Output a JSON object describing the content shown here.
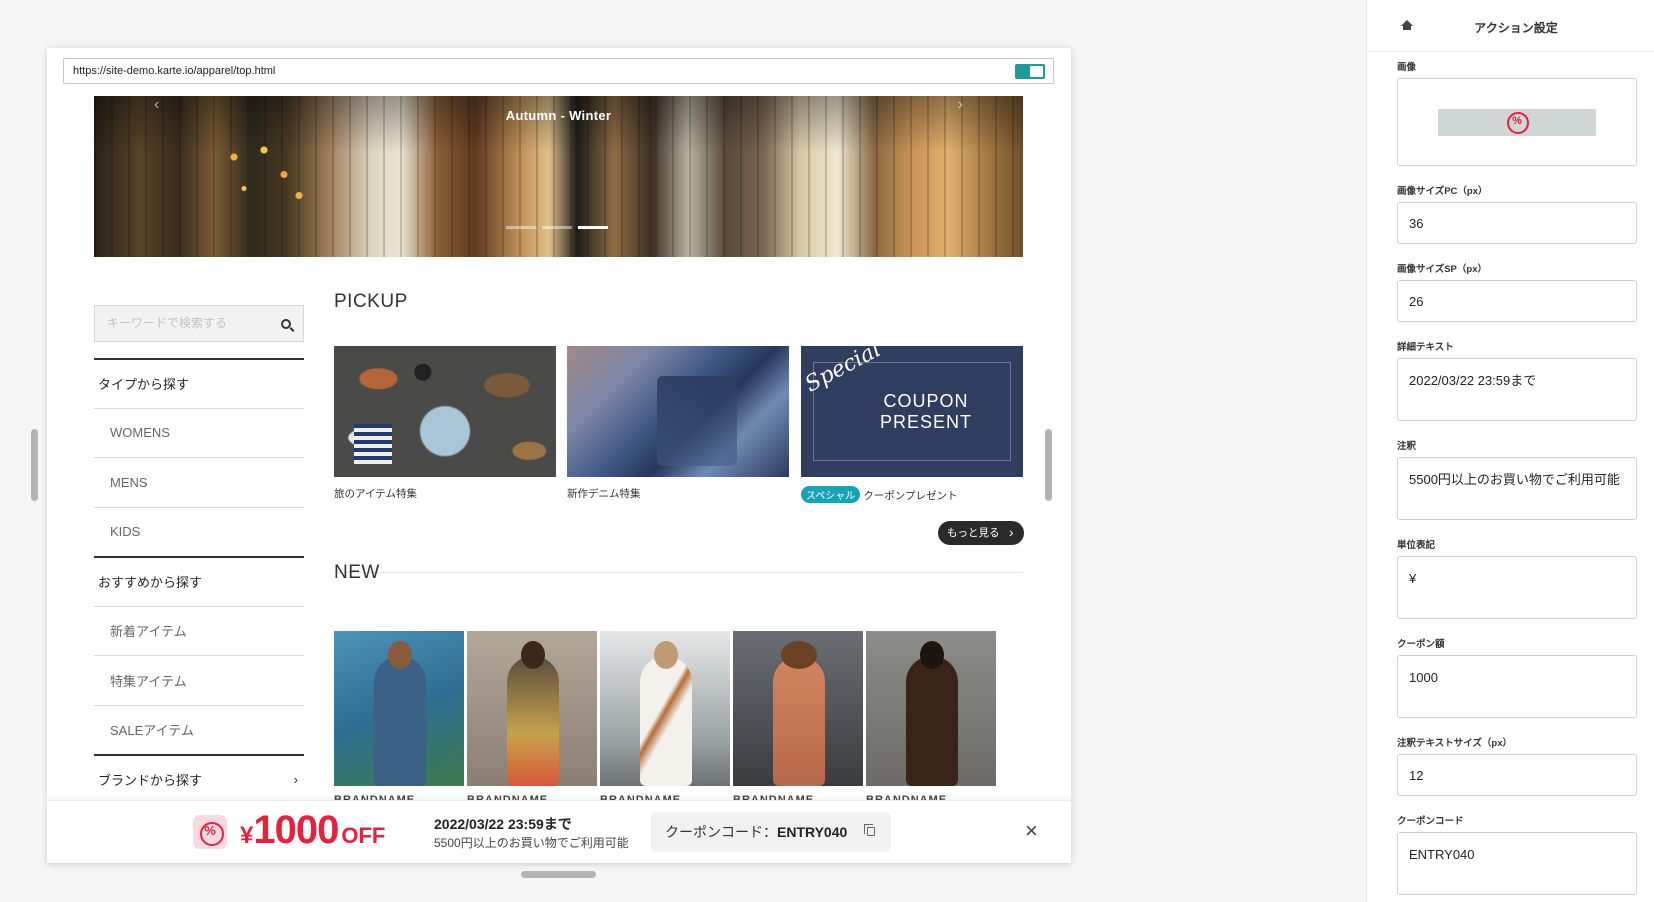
{
  "browser": {
    "url": "https://site-demo.karte.io/apparel/top.html"
  },
  "hero": {
    "title": "Autumn - Winter",
    "dot_count": 3,
    "active_dot": 3
  },
  "search": {
    "placeholder": "キーワードで検索する"
  },
  "sidebar": {
    "items": [
      {
        "label": "タイプから探す",
        "type": "head"
      },
      {
        "label": "WOMENS",
        "type": "sub"
      },
      {
        "label": "MENS",
        "type": "sub"
      },
      {
        "label": "KIDS",
        "type": "sub"
      },
      {
        "label": "おすすめから探す",
        "type": "head"
      },
      {
        "label": "新着アイテム",
        "type": "sub"
      },
      {
        "label": "特集アイテム",
        "type": "sub"
      },
      {
        "label": "SALEアイテム",
        "type": "sub"
      },
      {
        "label": "ブランドから探す",
        "type": "head",
        "chevron": "›"
      }
    ]
  },
  "pickup": {
    "title": "PICKUP",
    "cards": [
      {
        "caption": "旅のアイテム特集"
      },
      {
        "caption": "新作デニム特集"
      },
      {
        "badge": "スペシャル",
        "caption": "クーポンプレゼント",
        "image_special": "Special",
        "image_line1": "COUPON",
        "image_line2": "PRESENT"
      }
    ],
    "more_label": "もっと見る"
  },
  "new_section": {
    "title": "NEW",
    "brand_label": "BRANDNAME"
  },
  "coupon_bar": {
    "yen": "¥",
    "amount": "1000",
    "off": "OFF",
    "deadline": "2022/03/22 23:59まで",
    "note": "5500円以上のお買い物でご利用可能",
    "code_label": "クーポンコード：",
    "code": "ENTRY040",
    "close": "×",
    "accent_color": "#e2223f"
  },
  "panel": {
    "title": "アクション設定",
    "fields": {
      "image": {
        "label": "画像"
      },
      "size_pc": {
        "label": "画像サイズPC（px）",
        "value": "36"
      },
      "size_sp": {
        "label": "画像サイズSP（px）",
        "value": "26"
      },
      "detail": {
        "label": "詳細テキスト",
        "value": "2022/03/22 23:59まで"
      },
      "note": {
        "label": "注釈",
        "value": "5500円以上のお買い物でご利用可能"
      },
      "unit": {
        "label": "単位表記",
        "value": "¥"
      },
      "amount": {
        "label": "クーポン額",
        "value": "1000"
      },
      "note_size": {
        "label": "注釈テキストサイズ（px）",
        "value": "12"
      },
      "code": {
        "label": "クーポンコード",
        "value": "ENTRY040"
      }
    }
  }
}
